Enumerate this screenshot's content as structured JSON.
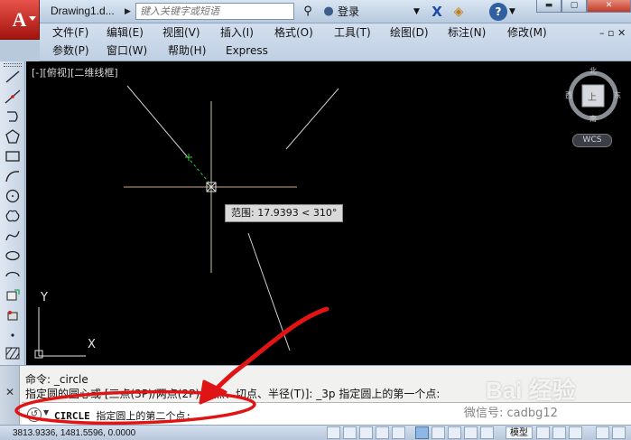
{
  "titlebar": {
    "doc_title": "Drawing1.d...",
    "search_placeholder": "键入关键字或短语",
    "login_label": "登录"
  },
  "menubar": {
    "row1": [
      "文件(F)",
      "编辑(E)",
      "视图(V)",
      "插入(I)",
      "格式(O)",
      "工具(T)",
      "绘图(D)",
      "标注(N)",
      "修改(M)"
    ],
    "row2": [
      "参数(P)",
      "窗口(W)",
      "帮助(H)",
      "Express"
    ]
  },
  "canvas": {
    "viewport_label": "[-][俯视][二维线框]",
    "tooltip": "范围: 17.9393 < 310°",
    "viewcube": {
      "north": "北",
      "south": "南",
      "east": "东",
      "west": "西",
      "face": "上"
    },
    "wcs_label": "WCS",
    "ucs": {
      "x_label": "X",
      "y_label": "Y"
    }
  },
  "command": {
    "history_1": "命令: _circle",
    "history_2": "指定圆的圆心或 [三点(3P)/两点(2P)/切点、切点、半径(T)]: _3p 指定圆上的第一个点:",
    "prompt_cmd": "CIRCLE",
    "prompt_text": "指定圆上的第二个点:"
  },
  "statusbar": {
    "coordinates": "3813.9336, 1481.5596, 0.0000",
    "model_label": "模型"
  },
  "watermark": {
    "site": "Bai 经验",
    "wechat": "微信号: cadbg12"
  },
  "colors": {
    "canvas_bg": "#000000",
    "annotation_red": "#e01414",
    "chrome_blue": "#c5d3e4"
  }
}
